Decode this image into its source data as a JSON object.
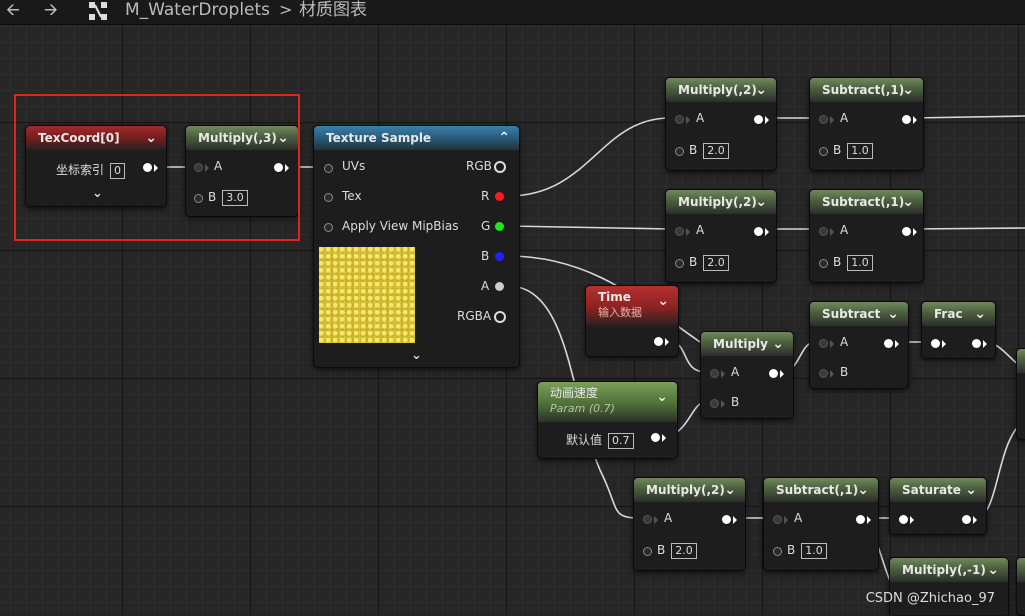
{
  "topbar": {
    "back_icon": "arrow-left-icon",
    "forward_icon": "arrow-right-icon",
    "graph_icon": "node-graph-icon",
    "asset_name": "M_WaterDroplets",
    "separator": ">",
    "section": "材质图表"
  },
  "nodes": {
    "texcoord": {
      "title": "TexCoord[0]",
      "label": "坐标索引",
      "value": "0"
    },
    "mul_1": {
      "title": "Multiply(,3)",
      "a": "A",
      "b": "B",
      "b_value": "3.0"
    },
    "texsample": {
      "title": "Texture Sample",
      "uvs": "UVs",
      "tex": "Tex",
      "mipbias": "Apply View MipBias",
      "rgb": "RGB",
      "r": "R",
      "g": "G",
      "b": "B",
      "a": "A",
      "rgba": "RGBA"
    },
    "mul_r": {
      "title": "Multiply(,2)",
      "a": "A",
      "b": "B",
      "b_value": "2.0"
    },
    "sub_r": {
      "title": "Subtract(,1)",
      "a": "A",
      "b": "B",
      "b_value": "1.0"
    },
    "mul_g": {
      "title": "Multiply(,2)",
      "a": "A",
      "b": "B",
      "b_value": "2.0"
    },
    "sub_g": {
      "title": "Subtract(,1)",
      "a": "A",
      "b": "B",
      "b_value": "1.0"
    },
    "time": {
      "title": "Time",
      "subtitle": "输入数据"
    },
    "subtract": {
      "title": "Subtract",
      "a": "A",
      "b": "B"
    },
    "frac": {
      "title": "Frac"
    },
    "multiply": {
      "title": "Multiply",
      "a": "A",
      "b": "B"
    },
    "param": {
      "title": "动画速度",
      "subtitle": "Param (0.7)",
      "label": "默认值",
      "value": "0.7"
    },
    "mul_a": {
      "title": "Multiply(,2)",
      "a": "A",
      "b": "B",
      "b_value": "2.0"
    },
    "sub_a": {
      "title": "Subtract(,1)",
      "a": "A",
      "b": "B",
      "b_value": "1.0"
    },
    "saturate": {
      "title": "Saturate"
    },
    "mul_neg": {
      "title": "Multiply(,-1)"
    }
  },
  "watermark": "CSDN @Zhichao_97"
}
